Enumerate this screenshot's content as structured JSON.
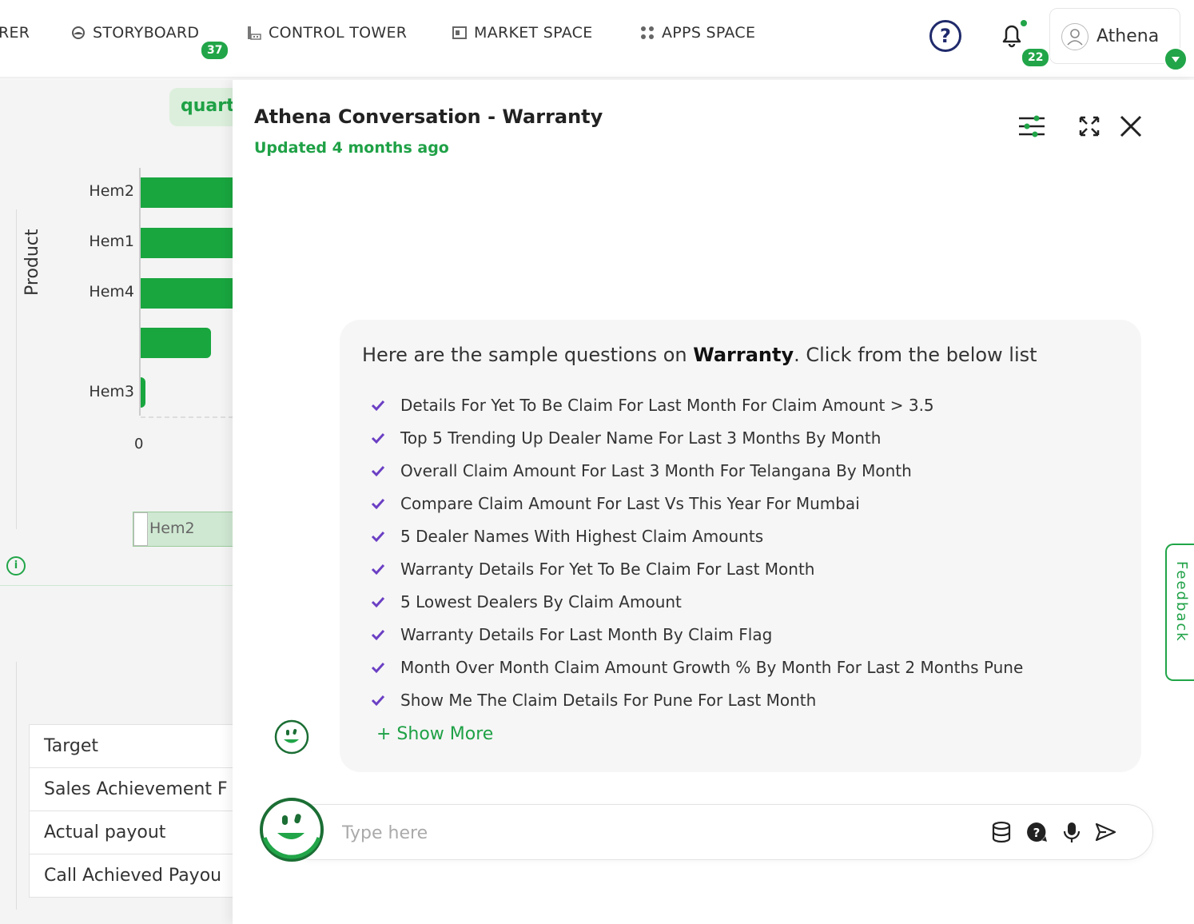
{
  "nav": {
    "items": [
      {
        "label": "RER",
        "icon": "none"
      },
      {
        "label": "STORYBOARD",
        "icon": "storyboard-icon",
        "badge": "37"
      },
      {
        "label": "CONTROL TOWER",
        "icon": "control-tower-icon"
      },
      {
        "label": "MARKET SPACE",
        "icon": "market-space-icon"
      },
      {
        "label": "APPS SPACE",
        "icon": "apps-grid-icon"
      }
    ],
    "help": "?",
    "notification_count": "22",
    "user_name": "Athena"
  },
  "background": {
    "chip": "quarte",
    "y_axis_label": "Product",
    "zero_tick": "0",
    "slider_label": "Hem2",
    "bars": [
      {
        "label": "Hem2",
        "value": 1.0
      },
      {
        "label": "Hem1",
        "value": 1.0
      },
      {
        "label": "Hem4",
        "value": 1.0
      },
      {
        "label": "",
        "value": 0.76
      },
      {
        "label": "Hem3",
        "value": 0.05
      }
    ],
    "table_rows": [
      "Target",
      "Sales Achievement F",
      "Actual payout",
      "Call Achieved Payou"
    ]
  },
  "panel": {
    "title": "Athena Conversation - Warranty",
    "subtitle": "Updated 4 months ago",
    "intro_before": "Here are the sample questions on ",
    "intro_bold": "Warranty",
    "intro_after": ". Click from the below list",
    "questions": [
      "Details For Yet To Be Claim For Last Month For Claim Amount > 3.5",
      "Top 5 Trending Up Dealer Name For Last 3 Months By Month",
      "Overall Claim Amount For Last 3 Month For Telangana By Month",
      "Compare Claim Amount For Last Vs This Year For Mumbai",
      "5 Dealer Names With Highest Claim Amounts",
      "Warranty Details For Yet To Be Claim For Last Month",
      "5 Lowest Dealers By Claim Amount",
      "Warranty Details For Last Month By Claim Flag",
      "Month Over Month Claim Amount Growth % By Month For Last 2 Months Pune",
      "Show Me The Claim Details For Pune For Last Month"
    ],
    "show_more": "+ Show More",
    "input_placeholder": "Type here",
    "feedback": "Feedback"
  },
  "colors": {
    "accent": "#1fa146",
    "check": "#6b3fc4",
    "navy": "#1f2a6b"
  }
}
